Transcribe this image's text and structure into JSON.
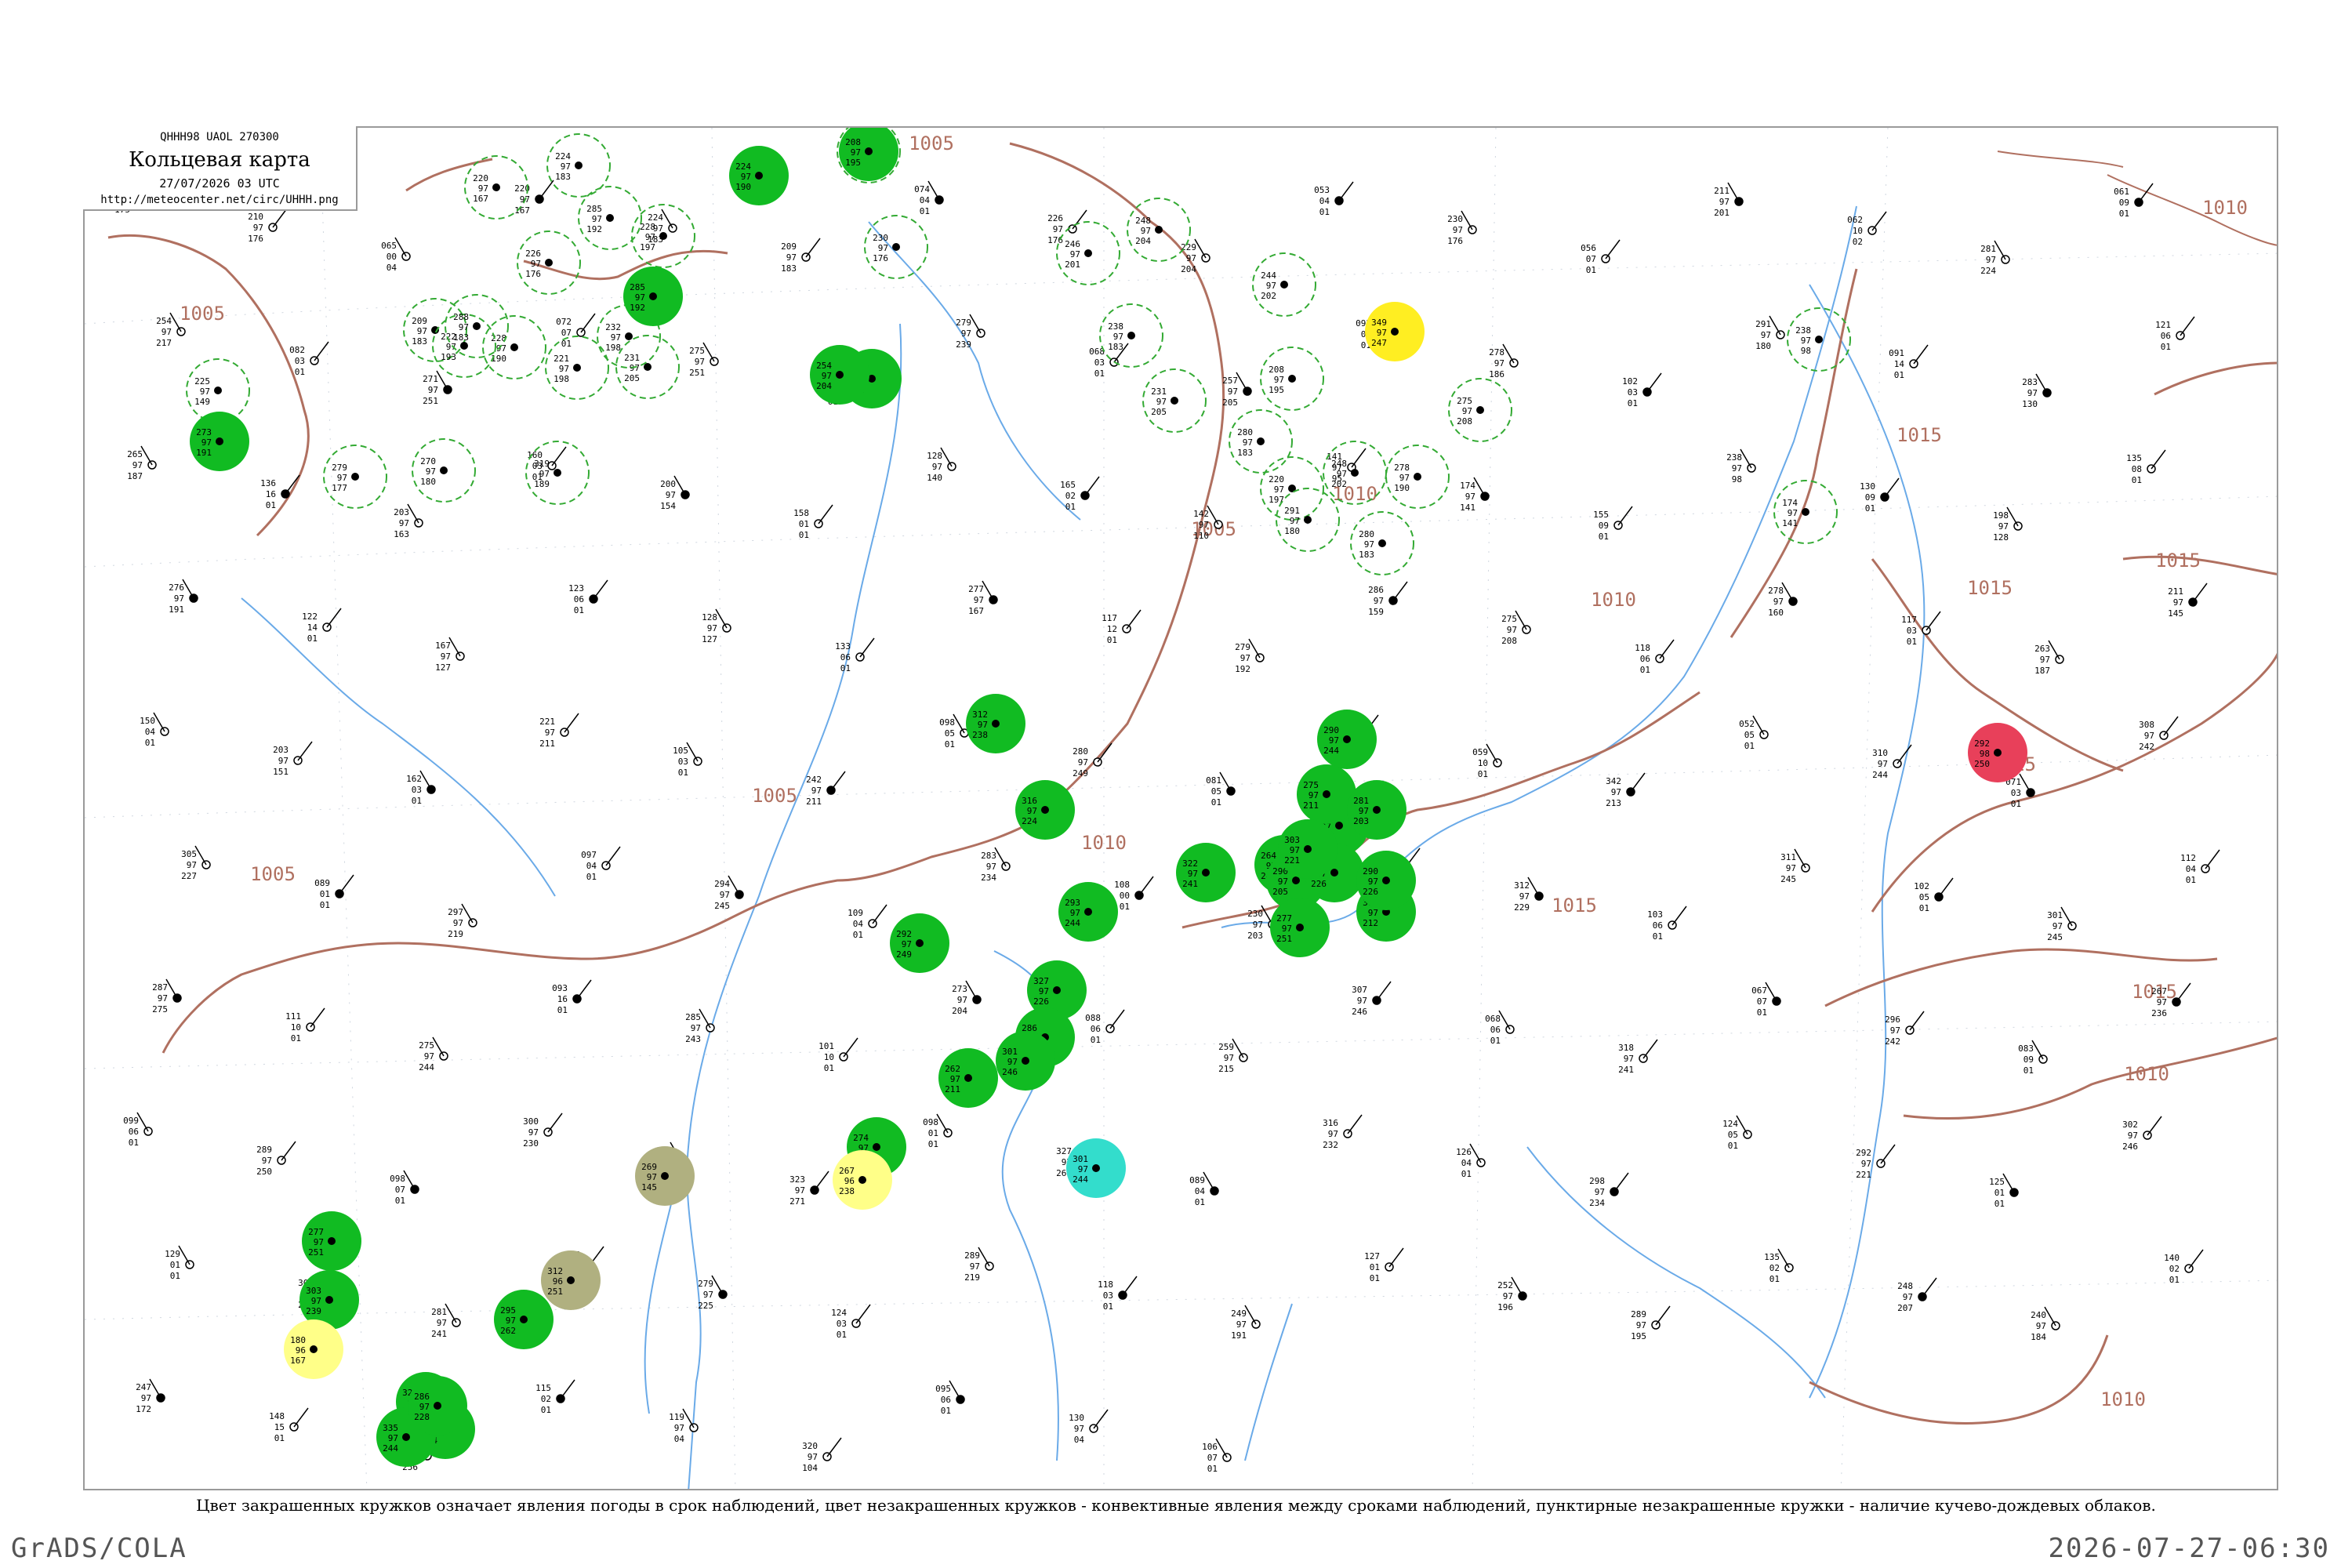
{
  "header": {
    "code": "QHHH98  UAOL  270300",
    "title": "Кольцевая карта",
    "time": "27/07/2026 03 UTC",
    "url": "http://meteocenter.net/circ/UHHH.png"
  },
  "caption": "Цвет закрашенных кружков означает явления погоды в срок наблюдений, цвет незакрашенных кружков - конвективные явления между сроками наблюдений, пунктирные незакрашенные кружки - наличие кучево-дождевых облаков.",
  "footer": {
    "left": "GrADS/COLA",
    "right": "2026-07-27-06:30"
  },
  "colors": {
    "isobar": "#b07060",
    "river": "#5aa0e0",
    "dashed_circle": "#33aa33",
    "green": "#11bb22",
    "yellow": "#ffee22",
    "light_yellow": "#ffff88",
    "khaki": "#b0b080",
    "red": "#e8405a",
    "cyan": "#33ddcc"
  },
  "isobar_labels": [
    "1005",
    "1005",
    "1005",
    "1005",
    "1005",
    "1005",
    "1010",
    "1010",
    "1010",
    "1010",
    "1015",
    "1015",
    "1015",
    "1015",
    "1015",
    "1015",
    "1010",
    "1010"
  ],
  "stations": [
    {
      "p": "238",
      "t": "97",
      "d": "175"
    },
    {
      "p": "210",
      "t": "97",
      "d": "176"
    },
    {
      "p": "065",
      "t": "00",
      "d": "04"
    },
    {
      "p": "220",
      "t": "97",
      "d": "167"
    },
    {
      "p": "224",
      "t": "97",
      "d": "183"
    },
    {
      "p": "209",
      "t": "97",
      "d": "183"
    },
    {
      "p": "074",
      "t": "04",
      "d": "01"
    },
    {
      "p": "226",
      "t": "97",
      "d": "176"
    },
    {
      "p": "229",
      "t": "97",
      "d": "204"
    },
    {
      "p": "053",
      "t": "04",
      "d": "01"
    },
    {
      "p": "230",
      "t": "97",
      "d": "176"
    },
    {
      "p": "056",
      "t": "07",
      "d": "01"
    },
    {
      "p": "211",
      "t": "97",
      "d": "201"
    },
    {
      "p": "062",
      "t": "10",
      "d": "02"
    },
    {
      "p": "281",
      "t": "97",
      "d": "224"
    },
    {
      "p": "061",
      "t": "09",
      "d": "01"
    },
    {
      "p": "254",
      "t": "97",
      "d": "217"
    },
    {
      "p": "082",
      "t": "03",
      "d": "01"
    },
    {
      "p": "271",
      "t": "97",
      "d": "251"
    },
    {
      "p": "072",
      "t": "07",
      "d": "01"
    },
    {
      "p": "275",
      "t": "97",
      "d": "251"
    },
    {
      "p": "065",
      "t": "10",
      "d": "01"
    },
    {
      "p": "279",
      "t": "97",
      "d": "239"
    },
    {
      "p": "068",
      "t": "03",
      "d": "01"
    },
    {
      "p": "257",
      "t": "97",
      "d": "205"
    },
    {
      "p": "092",
      "t": "03",
      "d": "01"
    },
    {
      "p": "278",
      "t": "97",
      "d": "186"
    },
    {
      "p": "102",
      "t": "03",
      "d": "01"
    },
    {
      "p": "291",
      "t": "97",
      "d": "180"
    },
    {
      "p": "091",
      "t": "14",
      "d": "01"
    },
    {
      "p": "283",
      "t": "97",
      "d": "130"
    },
    {
      "p": "121",
      "t": "06",
      "d": "01"
    },
    {
      "p": "265",
      "t": "97",
      "d": "187"
    },
    {
      "p": "136",
      "t": "16",
      "d": "01"
    },
    {
      "p": "203",
      "t": "97",
      "d": "163"
    },
    {
      "p": "160",
      "t": "03",
      "d": "01"
    },
    {
      "p": "200",
      "t": "97",
      "d": "154"
    },
    {
      "p": "158",
      "t": "01",
      "d": "01"
    },
    {
      "p": "128",
      "t": "97",
      "d": "140"
    },
    {
      "p": "165",
      "t": "02",
      "d": "01"
    },
    {
      "p": "142",
      "t": "97",
      "d": "110"
    },
    {
      "p": "141",
      "t": "97",
      "d": "95"
    },
    {
      "p": "174",
      "t": "97",
      "d": "141"
    },
    {
      "p": "155",
      "t": "09",
      "d": "01"
    },
    {
      "p": "238",
      "t": "97",
      "d": "98"
    },
    {
      "p": "130",
      "t": "09",
      "d": "01"
    },
    {
      "p": "198",
      "t": "97",
      "d": "128"
    },
    {
      "p": "135",
      "t": "08",
      "d": "01"
    },
    {
      "p": "276",
      "t": "97",
      "d": "191"
    },
    {
      "p": "122",
      "t": "14",
      "d": "01"
    },
    {
      "p": "167",
      "t": "97",
      "d": "127"
    },
    {
      "p": "123",
      "t": "06",
      "d": "01"
    },
    {
      "p": "128",
      "t": "97",
      "d": "127"
    },
    {
      "p": "133",
      "t": "06",
      "d": "01"
    },
    {
      "p": "277",
      "t": "97",
      "d": "167"
    },
    {
      "p": "117",
      "t": "12",
      "d": "01"
    },
    {
      "p": "279",
      "t": "97",
      "d": "192"
    },
    {
      "p": "286",
      "t": "97",
      "d": "159"
    },
    {
      "p": "275",
      "t": "97",
      "d": "208"
    },
    {
      "p": "118",
      "t": "06",
      "d": "01"
    },
    {
      "p": "278",
      "t": "97",
      "d": "160"
    },
    {
      "p": "117",
      "t": "03",
      "d": "01"
    },
    {
      "p": "263",
      "t": "97",
      "d": "187"
    },
    {
      "p": "211",
      "t": "97",
      "d": "145"
    },
    {
      "p": "150",
      "t": "04",
      "d": "01"
    },
    {
      "p": "203",
      "t": "97",
      "d": "151"
    },
    {
      "p": "162",
      "t": "03",
      "d": "01"
    },
    {
      "p": "221",
      "t": "97",
      "d": "211"
    },
    {
      "p": "105",
      "t": "03",
      "d": "01"
    },
    {
      "p": "242",
      "t": "97",
      "d": "211"
    },
    {
      "p": "098",
      "t": "05",
      "d": "01"
    },
    {
      "p": "280",
      "t": "97",
      "d": "249"
    },
    {
      "p": "081",
      "t": "05",
      "d": "01"
    },
    {
      "p": "326",
      "t": "97",
      "d": "238"
    },
    {
      "p": "059",
      "t": "10",
      "d": "01"
    },
    {
      "p": "342",
      "t": "97",
      "d": "213"
    },
    {
      "p": "052",
      "t": "05",
      "d": "01"
    },
    {
      "p": "310",
      "t": "97",
      "d": "244"
    },
    {
      "p": "071",
      "t": "03",
      "d": "01"
    },
    {
      "p": "308",
      "t": "97",
      "d": "242"
    },
    {
      "p": "305",
      "t": "97",
      "d": "227"
    },
    {
      "p": "089",
      "t": "01",
      "d": "01"
    },
    {
      "p": "297",
      "t": "97",
      "d": "219"
    },
    {
      "p": "097",
      "t": "04",
      "d": "01"
    },
    {
      "p": "294",
      "t": "97",
      "d": "245"
    },
    {
      "p": "109",
      "t": "04",
      "d": "01"
    },
    {
      "p": "283",
      "t": "97",
      "d": "234"
    },
    {
      "p": "108",
      "t": "00",
      "d": "01"
    },
    {
      "p": "230",
      "t": "97",
      "d": "203"
    },
    {
      "p": "093",
      "t": "03",
      "d": "01"
    },
    {
      "p": "312",
      "t": "97",
      "d": "229"
    },
    {
      "p": "103",
      "t": "06",
      "d": "01"
    },
    {
      "p": "311",
      "t": "97",
      "d": "245"
    },
    {
      "p": "102",
      "t": "05",
      "d": "01"
    },
    {
      "p": "301",
      "t": "97",
      "d": "245"
    },
    {
      "p": "112",
      "t": "04",
      "d": "01"
    },
    {
      "p": "287",
      "t": "97",
      "d": "275"
    },
    {
      "p": "111",
      "t": "10",
      "d": "01"
    },
    {
      "p": "275",
      "t": "97",
      "d": "244"
    },
    {
      "p": "093",
      "t": "16",
      "d": "01"
    },
    {
      "p": "285",
      "t": "97",
      "d": "243"
    },
    {
      "p": "101",
      "t": "10",
      "d": "01"
    },
    {
      "p": "273",
      "t": "97",
      "d": "204"
    },
    {
      "p": "088",
      "t": "06",
      "d": "01"
    },
    {
      "p": "259",
      "t": "97",
      "d": "215"
    },
    {
      "p": "307",
      "t": "97",
      "d": "246"
    },
    {
      "p": "068",
      "t": "06",
      "d": "01"
    },
    {
      "p": "318",
      "t": "97",
      "d": "241"
    },
    {
      "p": "067",
      "t": "07",
      "d": "01"
    },
    {
      "p": "296",
      "t": "97",
      "d": "242"
    },
    {
      "p": "083",
      "t": "09",
      "d": "01"
    },
    {
      "p": "267",
      "t": "97",
      "d": "236"
    },
    {
      "p": "099",
      "t": "06",
      "d": "01"
    },
    {
      "p": "289",
      "t": "97",
      "d": "250"
    },
    {
      "p": "098",
      "t": "07",
      "d": "01"
    },
    {
      "p": "300",
      "t": "97",
      "d": "230"
    },
    {
      "p": "106",
      "t": "02",
      "d": "01"
    },
    {
      "p": "323",
      "t": "97",
      "d": "271"
    },
    {
      "p": "098",
      "t": "01",
      "d": "01"
    },
    {
      "p": "327",
      "t": "97",
      "d": "260"
    },
    {
      "p": "089",
      "t": "04",
      "d": "01"
    },
    {
      "p": "316",
      "t": "97",
      "d": "232"
    },
    {
      "p": "126",
      "t": "04",
      "d": "01"
    },
    {
      "p": "298",
      "t": "97",
      "d": "234"
    },
    {
      "p": "124",
      "t": "05",
      "d": "01"
    },
    {
      "p": "292",
      "t": "97",
      "d": "221"
    },
    {
      "p": "125",
      "t": "01",
      "d": "01"
    },
    {
      "p": "302",
      "t": "97",
      "d": "246"
    },
    {
      "p": "129",
      "t": "01",
      "d": "01"
    },
    {
      "p": "306",
      "t": "97",
      "d": "240"
    },
    {
      "p": "281",
      "t": "97",
      "d": "241"
    },
    {
      "p": "125",
      "t": "03",
      "d": "01"
    },
    {
      "p": "279",
      "t": "97",
      "d": "225"
    },
    {
      "p": "124",
      "t": "03",
      "d": "01"
    },
    {
      "p": "289",
      "t": "97",
      "d": "219"
    },
    {
      "p": "118",
      "t": "03",
      "d": "01"
    },
    {
      "p": "249",
      "t": "97",
      "d": "191"
    },
    {
      "p": "127",
      "t": "01",
      "d": "01"
    },
    {
      "p": "252",
      "t": "97",
      "d": "196"
    },
    {
      "p": "289",
      "t": "97",
      "d": "195"
    },
    {
      "p": "135",
      "t": "02",
      "d": "01"
    },
    {
      "p": "248",
      "t": "97",
      "d": "207"
    },
    {
      "p": "240",
      "t": "97",
      "d": "184"
    },
    {
      "p": "140",
      "t": "02",
      "d": "01"
    },
    {
      "p": "247",
      "t": "97",
      "d": "172"
    },
    {
      "p": "148",
      "t": "15",
      "d": "01"
    },
    {
      "p": "312",
      "t": "97",
      "d": "256"
    },
    {
      "p": "115",
      "t": "02",
      "d": "01"
    },
    {
      "p": "119",
      "t": "97",
      "d": "04"
    },
    {
      "p": "320",
      "t": "97",
      "d": "104"
    },
    {
      "p": "095",
      "t": "06",
      "d": "01"
    },
    {
      "p": "130",
      "t": "97",
      "d": "04"
    },
    {
      "p": "106",
      "t": "07",
      "d": "01"
    }
  ],
  "circles": [
    {
      "style": "dashed",
      "p": "224",
      "t": "97",
      "d": "183"
    },
    {
      "style": "dashed",
      "p": "220",
      "t": "97",
      "d": "167"
    },
    {
      "style": "dashed",
      "p": "226",
      "t": "97",
      "d": "176"
    },
    {
      "style": "dashed",
      "p": "285",
      "t": "97",
      "d": "192"
    },
    {
      "style": "dashed",
      "p": "228",
      "t": "97",
      "d": "190"
    },
    {
      "style": "dashed",
      "p": "209",
      "t": "97",
      "d": "183"
    },
    {
      "style": "dashed",
      "p": "225",
      "t": "97",
      "d": "149"
    },
    {
      "style": "dashed",
      "p": "279",
      "t": "97",
      "d": "177"
    },
    {
      "style": "dashed",
      "p": "270",
      "t": "97",
      "d": "180"
    },
    {
      "style": "dashed",
      "p": "319",
      "t": "97",
      "d": "189"
    },
    {
      "style": "dashed",
      "p": "221",
      "t": "97",
      "d": "198"
    },
    {
      "style": "dashed",
      "p": "231",
      "t": "97",
      "d": "205"
    },
    {
      "style": "dashed",
      "p": "222",
      "t": "97",
      "d": "193"
    },
    {
      "style": "dashed",
      "p": "288",
      "t": "97",
      "d": "183"
    },
    {
      "style": "dashed",
      "p": "232",
      "t": "97",
      "d": "198"
    },
    {
      "style": "dashed",
      "p": "228",
      "t": "97",
      "d": "197"
    },
    {
      "style": "dashed",
      "p": "230",
      "t": "97",
      "d": "176"
    },
    {
      "style": "dashed",
      "p": "246",
      "t": "97",
      "d": "201"
    },
    {
      "style": "dashed",
      "p": "248",
      "t": "97",
      "d": "204"
    },
    {
      "style": "dashed",
      "p": "238",
      "t": "97",
      "d": "183"
    },
    {
      "style": "dashed",
      "p": "231",
      "t": "97",
      "d": "205"
    },
    {
      "style": "dashed",
      "p": "244",
      "t": "97",
      "d": "202"
    },
    {
      "style": "dashed",
      "p": "248",
      "t": "97",
      "d": "202"
    },
    {
      "style": "dashed",
      "p": "220",
      "t": "97",
      "d": "197"
    },
    {
      "style": "dashed",
      "p": "280",
      "t": "97",
      "d": "183"
    },
    {
      "style": "dashed",
      "p": "291",
      "t": "97",
      "d": "180"
    },
    {
      "style": "dashed",
      "p": "280",
      "t": "97",
      "d": "183"
    },
    {
      "style": "dashed",
      "p": "278",
      "t": "97",
      "d": "190"
    },
    {
      "style": "dashed",
      "p": "275",
      "t": "97",
      "d": "208"
    },
    {
      "style": "dashed",
      "p": "174",
      "t": "97",
      "d": "141"
    },
    {
      "style": "dashed",
      "p": "238",
      "t": "97",
      "d": "98"
    },
    {
      "style": "dashed",
      "p": "208",
      "t": "97",
      "d": "195"
    },
    {
      "style": "dashed",
      "p": "223",
      "t": "97",
      "d": "191"
    },
    {
      "style": "green",
      "p": "285",
      "t": "97",
      "d": "192"
    },
    {
      "style": "green",
      "p": "208",
      "t": "97",
      "d": "195"
    },
    {
      "style": "green",
      "p": "223",
      "t": "97",
      "d": "191"
    },
    {
      "style": "green",
      "p": "224",
      "t": "97",
      "d": "190"
    },
    {
      "style": "green",
      "p": "254",
      "t": "97",
      "d": "204"
    },
    {
      "style": "green",
      "p": "273",
      "t": "97",
      "d": "191"
    },
    {
      "style": "green",
      "p": "292",
      "t": "97",
      "d": "249"
    },
    {
      "style": "green",
      "p": "312",
      "t": "97",
      "d": "238"
    },
    {
      "style": "green",
      "p": "262",
      "t": "97",
      "d": "211"
    },
    {
      "style": "green",
      "p": "316",
      "t": "97",
      "d": "224"
    },
    {
      "style": "green",
      "p": "293",
      "t": "97",
      "d": "244"
    },
    {
      "style": "green",
      "p": "322",
      "t": "97",
      "d": "241"
    },
    {
      "style": "green",
      "p": "264",
      "t": "97",
      "d": "241"
    },
    {
      "style": "green",
      "p": "290",
      "t": "97",
      "d": "244"
    },
    {
      "style": "green",
      "p": "297",
      "t": "97",
      "d": "231"
    },
    {
      "style": "green",
      "p": "304",
      "t": "97",
      "d": "212"
    },
    {
      "style": "green",
      "p": "275",
      "t": "97",
      "d": "211"
    },
    {
      "style": "green",
      "p": "281",
      "t": "97",
      "d": "203"
    },
    {
      "style": "green",
      "p": "290",
      "t": "97",
      "d": "205"
    },
    {
      "style": "green",
      "p": "312",
      "t": "97",
      "d": "226"
    },
    {
      "style": "green",
      "p": "277",
      "t": "97",
      "d": "251"
    },
    {
      "style": "green",
      "p": "290",
      "t": "97",
      "d": "226"
    },
    {
      "style": "green",
      "p": "303",
      "t": "97",
      "d": "221"
    },
    {
      "style": "green",
      "p": "327",
      "t": "97",
      "d": "226"
    },
    {
      "style": "green",
      "p": "286",
      "t": "97",
      "d": "228"
    },
    {
      "style": "green",
      "p": "301",
      "t": "97",
      "d": "246"
    },
    {
      "style": "green",
      "p": "274",
      "t": "97",
      "d": "232"
    },
    {
      "style": "green",
      "p": "277",
      "t": "97",
      "d": "251"
    },
    {
      "style": "green",
      "p": "303",
      "t": "97",
      "d": "239"
    },
    {
      "style": "green",
      "p": "322",
      "t": "97",
      "d": "261"
    },
    {
      "style": "green",
      "p": "333",
      "t": "97",
      "d": "274"
    },
    {
      "style": "green",
      "p": "335",
      "t": "97",
      "d": "244"
    },
    {
      "style": "green",
      "p": "286",
      "t": "97",
      "d": "228"
    },
    {
      "style": "green",
      "p": "295",
      "t": "97",
      "d": "262"
    },
    {
      "style": "khaki",
      "p": "312",
      "t": "96",
      "d": "251"
    },
    {
      "style": "khaki",
      "p": "269",
      "t": "97",
      "d": "145"
    },
    {
      "style": "yellow",
      "p": "349",
      "t": "97",
      "d": "247"
    },
    {
      "style": "light_yellow",
      "p": "267",
      "t": "96",
      "d": "238"
    },
    {
      "style": "light_yellow",
      "p": "180",
      "t": "96",
      "d": "167"
    },
    {
      "style": "red",
      "p": "292",
      "t": "98",
      "d": "250"
    },
    {
      "style": "cyan",
      "p": "301",
      "t": "97",
      "d": "244"
    }
  ]
}
